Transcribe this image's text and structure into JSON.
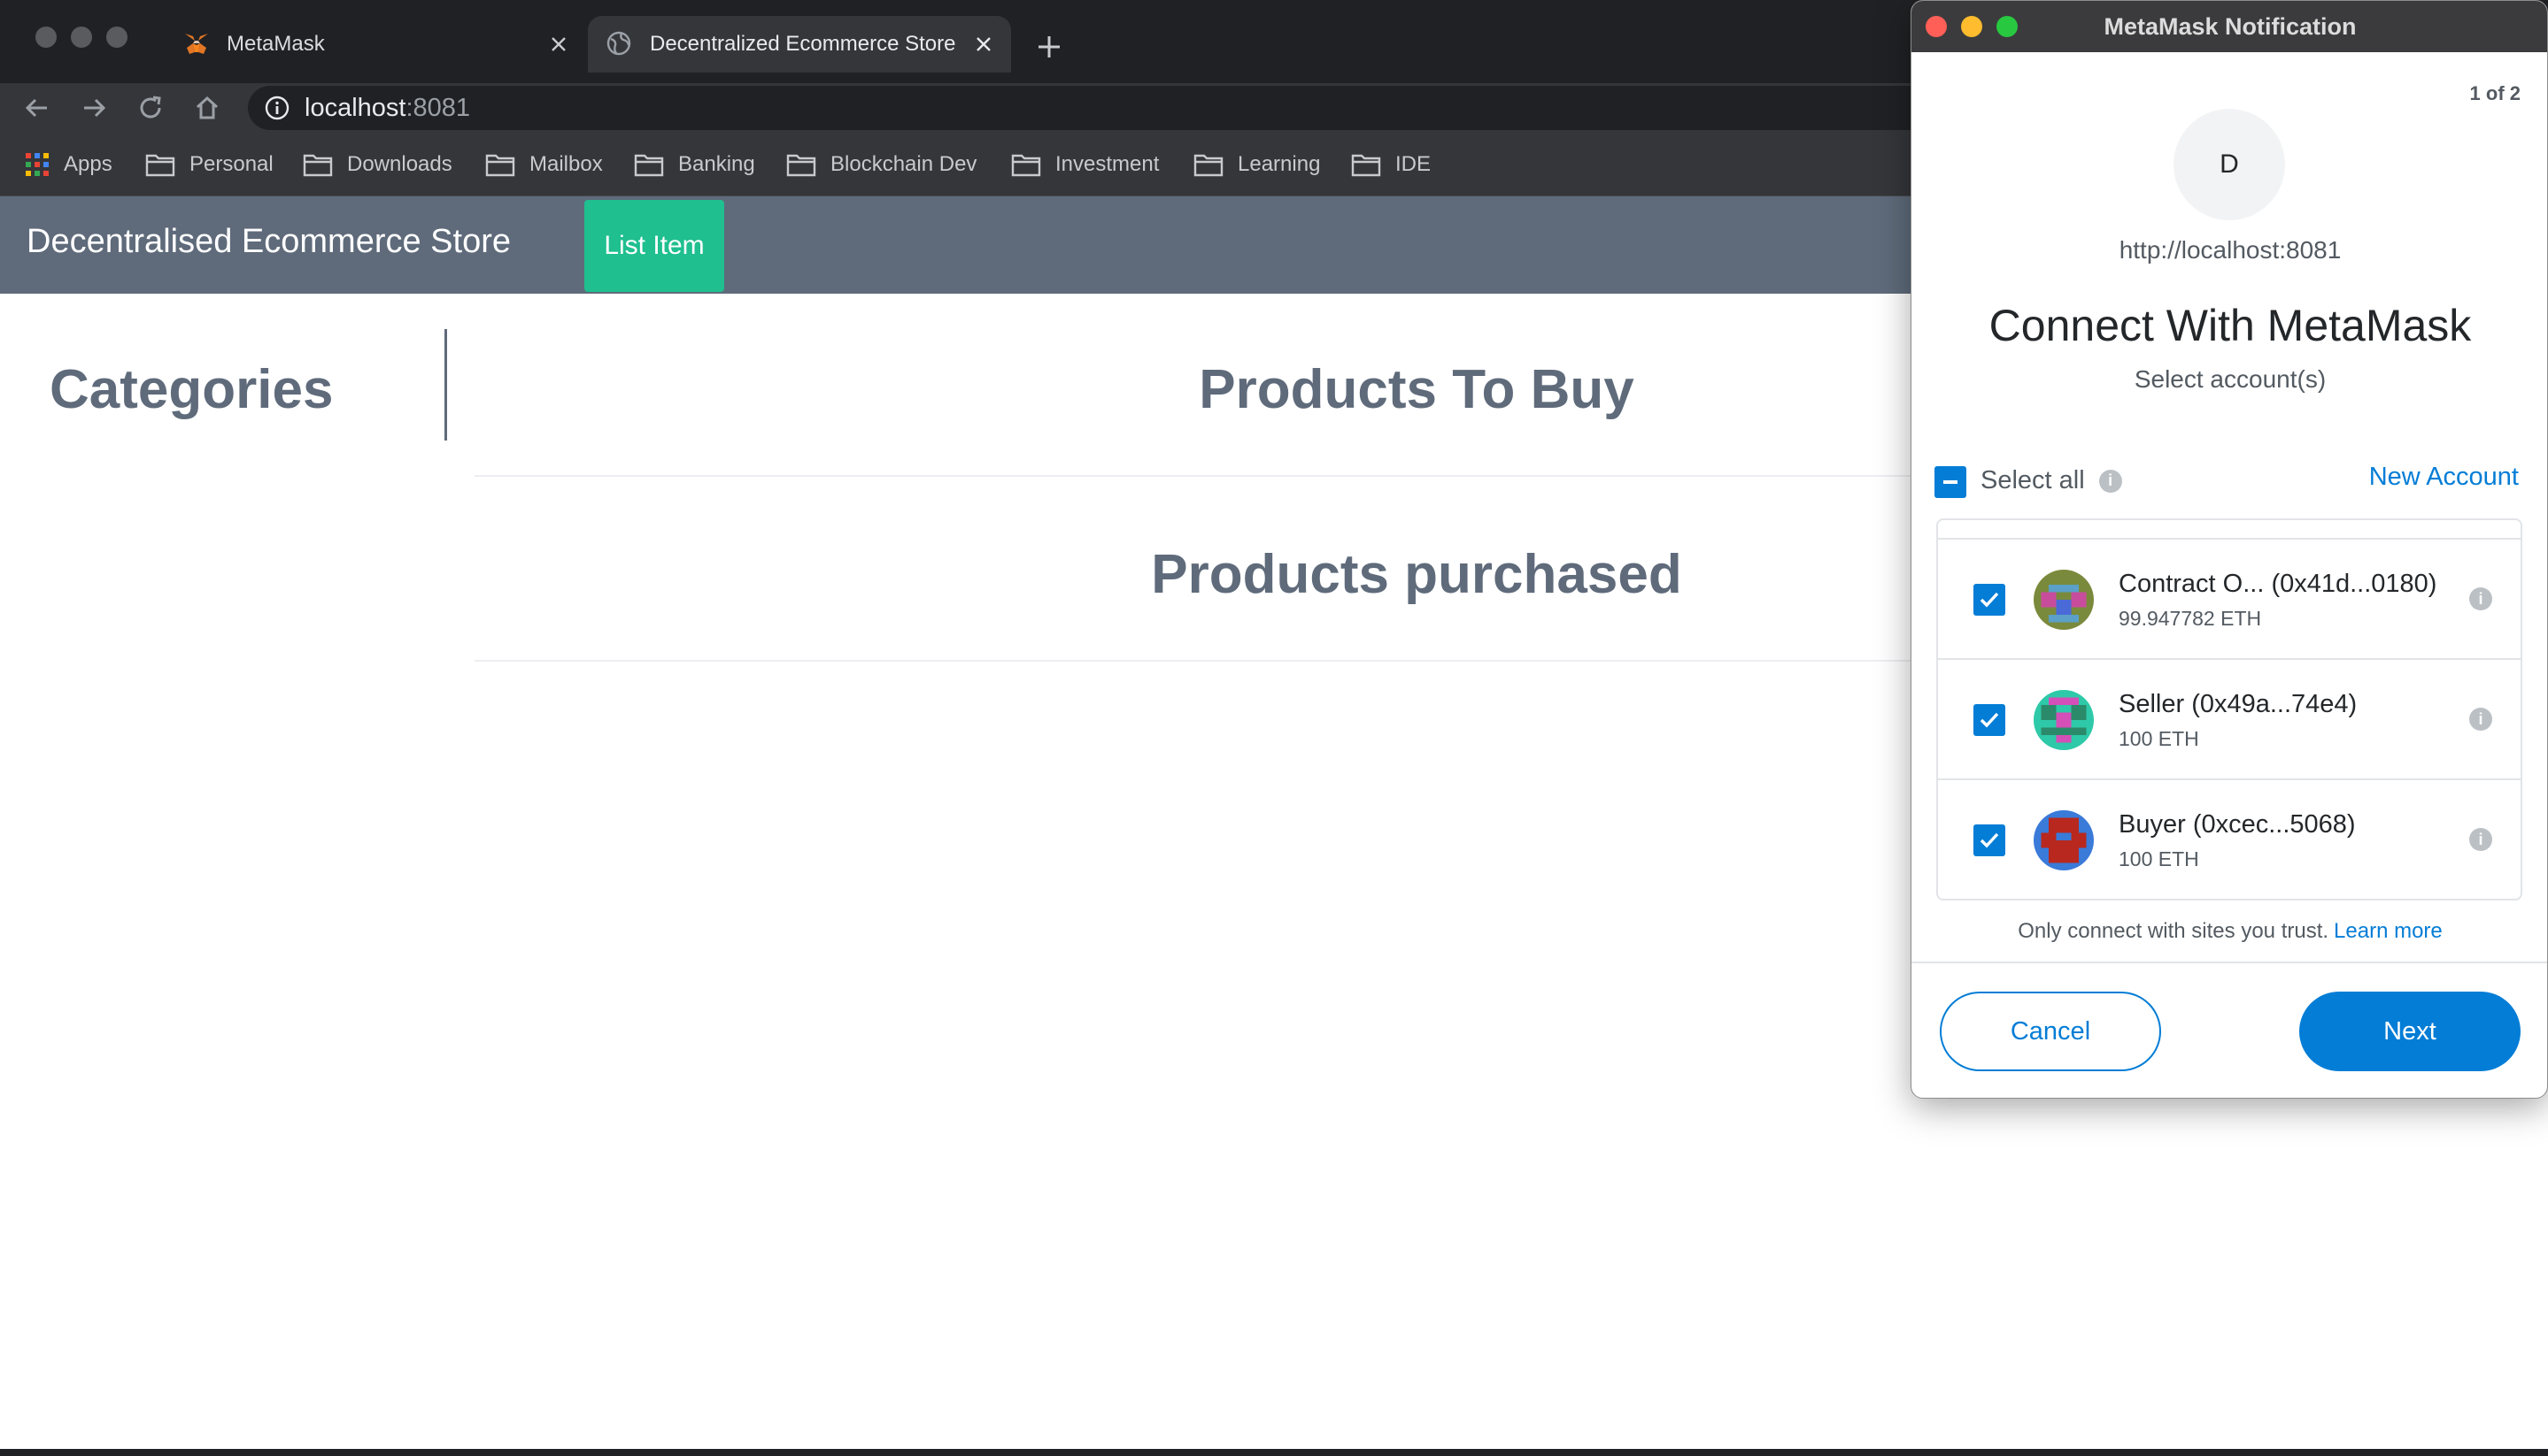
{
  "browser": {
    "tabs": [
      {
        "title": "MetaMask",
        "icon": "metamask-fox-icon",
        "active": false
      },
      {
        "title": "Decentralized Ecommerce Store",
        "icon": "globe-icon",
        "active": true
      }
    ],
    "url_host": "localhost",
    "url_port": ":8081",
    "bookmarks": [
      {
        "label": "Apps",
        "icon": "apps-grid-icon"
      },
      {
        "label": "Personal",
        "icon": "folder-icon"
      },
      {
        "label": "Downloads",
        "icon": "folder-icon"
      },
      {
        "label": "Mailbox",
        "icon": "folder-icon"
      },
      {
        "label": "Banking",
        "icon": "folder-icon"
      },
      {
        "label": "Blockchain Dev",
        "icon": "folder-icon"
      },
      {
        "label": "Investment",
        "icon": "folder-icon"
      },
      {
        "label": "Learning",
        "icon": "folder-icon"
      },
      {
        "label": "IDE",
        "icon": "folder-icon"
      }
    ]
  },
  "page": {
    "brand": "Decentralised Ecommerce Store",
    "list_item_label": "List Item",
    "categories_heading": "Categories",
    "products_to_buy_heading": "Products To Buy",
    "products_purchased_heading": "Products purchased",
    "nav_color": "#5f6b7b",
    "button_color": "#1fbf8f"
  },
  "metamask": {
    "window_title": "MetaMask Notification",
    "page_indicator": "1 of 2",
    "site_initial": "D",
    "origin": "http://localhost:8081",
    "heading": "Connect With MetaMask",
    "subheading": "Select account(s)",
    "select_all_label": "Select all",
    "new_account_label": "New Account",
    "accounts": [
      {
        "name": "Contract O... (0x41d...0180)",
        "balance": "99.947782 ETH",
        "checked": true
      },
      {
        "name": "Seller (0x49a...74e4)",
        "balance": "100 ETH",
        "checked": true
      },
      {
        "name": "Buyer (0xcec...5068)",
        "balance": "100 ETH",
        "checked": true
      }
    ],
    "trust_text": "Only connect with sites you trust.",
    "learn_more_label": "Learn more",
    "cancel_label": "Cancel",
    "next_label": "Next",
    "accent_color": "#037dd6"
  }
}
